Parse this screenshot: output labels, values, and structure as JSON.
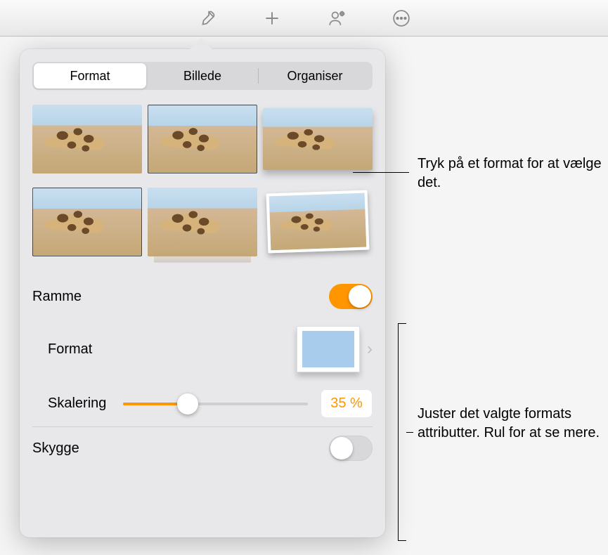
{
  "toolbar": {
    "icons": [
      "brush-icon",
      "plus-icon",
      "collaborate-icon",
      "more-icon"
    ]
  },
  "tabs": {
    "items": [
      {
        "label": "Format",
        "active": true
      },
      {
        "label": "Billede",
        "active": false
      },
      {
        "label": "Organiser",
        "active": false
      }
    ]
  },
  "styles": {
    "thumbs": [
      {
        "variant": "plain"
      },
      {
        "variant": "border-thin"
      },
      {
        "variant": "shadow"
      },
      {
        "variant": "border-thin"
      },
      {
        "variant": "reflect"
      },
      {
        "variant": "paper"
      }
    ]
  },
  "frame": {
    "label": "Ramme",
    "enabled": true,
    "format_label": "Format",
    "scaling_label": "Skalering",
    "scaling_value": 35,
    "scaling_display": "35 %"
  },
  "shadow": {
    "label": "Skygge",
    "enabled": false
  },
  "colors": {
    "accent": "#ff9500"
  },
  "callouts": {
    "c1": "Tryk på et format for at vælge det.",
    "c2": "Juster det valgte formats attributter. Rul for at se mere."
  }
}
